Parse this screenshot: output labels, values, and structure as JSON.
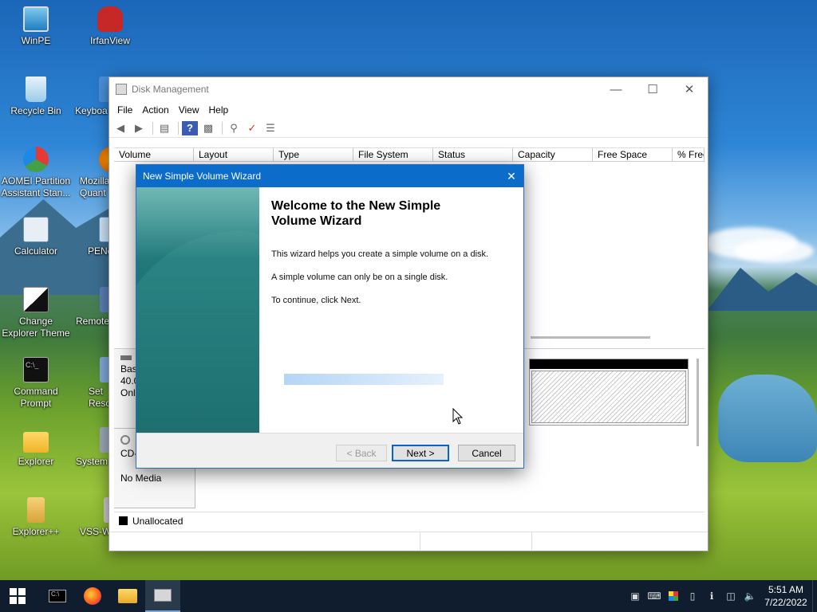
{
  "desktop": {
    "icons": [
      {
        "label": "WinPE"
      },
      {
        "label": "IrfanView"
      },
      {
        "label": "Recycle Bin"
      },
      {
        "label": "Keyboa"
      },
      {
        "label": "AOMEI Partition Assistant Stan..."
      },
      {
        "label": "Mozilla Quant"
      },
      {
        "label": "Calculator"
      },
      {
        "label": "PENe"
      },
      {
        "label": "Change Explorer Theme"
      },
      {
        "label": "Remote"
      },
      {
        "label": "Command Prompt"
      },
      {
        "label": "Set Reso"
      },
      {
        "label": "Explorer"
      },
      {
        "label": "System"
      },
      {
        "label": "Explorer++"
      },
      {
        "label": "VSS-W"
      }
    ]
  },
  "disk_management": {
    "title": "Disk Management",
    "menu": [
      "File",
      "Action",
      "View",
      "Help"
    ],
    "columns": [
      "Volume",
      "Layout",
      "Type",
      "File System",
      "Status",
      "Capacity",
      "Free Space",
      "% Free"
    ],
    "disk0": {
      "line1": "Bas",
      "line2": "40.0",
      "line3": "Onl"
    },
    "cdrom": {
      "line1": "CD-",
      "line2": "No Media"
    },
    "legend": {
      "unallocated": "Unallocated",
      "color": "#000000"
    }
  },
  "wizard": {
    "title": "New Simple Volume Wizard",
    "heading": "Welcome to the New Simple Volume Wizard",
    "paragraphs": [
      "This wizard helps you create a simple volume on a disk.",
      "A simple volume can only be on a single disk.",
      "To continue, click Next."
    ],
    "buttons": {
      "back": "< Back",
      "next": "Next >",
      "cancel": "Cancel"
    },
    "accent": "#0c6cc9"
  },
  "taskbar": {
    "time": "5:51 AM",
    "date": "7/22/2022"
  }
}
